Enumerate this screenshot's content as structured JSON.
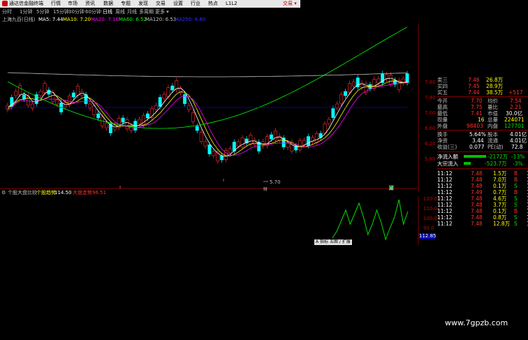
{
  "menu": {
    "app_title": "通达信金融终端",
    "items": [
      "行情",
      "市场",
      "资讯",
      "数据",
      "专题",
      "发现",
      "交易",
      "设置",
      "行业",
      "热点",
      "L1L2"
    ],
    "trade_label": "交易 ▾"
  },
  "period_bar": {
    "items": [
      "分时",
      "1分钟",
      "5分钟",
      "15分钟",
      "30分钟",
      "60分钟",
      "日线",
      "周线",
      "月线",
      "多周期",
      "更多 ▾"
    ],
    "active": "日线"
  },
  "ma_legend": {
    "stock_label": "上海九百(日线)",
    "ma5": "MA5: 7.44",
    "ma10": "MA10: 7.20",
    "ma20": "MA20: 7.16",
    "ma60": "MA60: 6.52",
    "ma120": "MA120: 6.53",
    "ma250": "MA250: 6.60",
    "colors": {
      "ma5": "#ffffff",
      "ma10": "#ffff00",
      "ma20": "#ff00ff",
      "ma60": "#00ff00",
      "ma120": "#c0c0c0",
      "ma250": "#0000ff"
    }
  },
  "main_chart": {
    "low_marker": "5.70",
    "event_marker": "财",
    "event_marker_right": "减",
    "axis_labels": [
      "7.80",
      "7.40",
      "7.00",
      "6.60",
      "6.20",
      "5.80"
    ]
  },
  "sub_chart": {
    "title": "个股大盘比较",
    "s1_label": "个股趋势",
    "s1_value": "114.50",
    "s2_label": "大盘走势",
    "s2_value": "96.51",
    "axis_labels": [
      "120.0",
      "110.0",
      "100.0",
      "90.0"
    ],
    "current_tag": "112.85",
    "tabs": [
      "A",
      "指标 五图",
      "/",
      "扩展"
    ]
  },
  "quote_panel": {
    "sell_rows": [
      {
        "label": "卖三",
        "price": "7.46",
        "vol": "26.8万"
      },
      {
        "label": "买四",
        "price": "7.45",
        "vol": "28.9万"
      },
      {
        "label": "买五",
        "price": "7.44",
        "vol": "38.5万",
        "extra": "+517"
      }
    ],
    "stats": [
      {
        "l1": "今开",
        "v1": "7.70",
        "l2": "均价",
        "v2": "7.54"
      },
      {
        "l1": "最高",
        "v1": "7.75",
        "l2": "量比",
        "v2": "2.21"
      },
      {
        "l1": "最低",
        "v1": "7.41",
        "l2": "市值",
        "v2": "30.0亿"
      },
      {
        "l1": "现量",
        "v1": "16",
        "l2": "总量",
        "v2": "224071"
      },
      {
        "l1": "外盘",
        "v1": "98403",
        "l2": "内盘",
        "v2": "127701"
      },
      {
        "l1": "换手",
        "v1": "5.64%",
        "l2": "股本",
        "v2": "4.01亿"
      },
      {
        "l1": "净资",
        "v1": "3.44",
        "l2": "流通",
        "v2": "4.01亿"
      },
      {
        "l1": "收益(三)",
        "v1": "0.077",
        "l2": "PE(动)",
        "v2": "72.8"
      }
    ],
    "flows": [
      {
        "label": "净流入额",
        "value": "-2172万",
        "pct": "-13%"
      },
      {
        "label": "大宗流入",
        "value": "-523.7万",
        "pct": "-3%"
      }
    ],
    "ticks": [
      {
        "time": "11:12",
        "price": "7.48",
        "vol": "1.5万",
        "side": "B",
        "n": "1"
      },
      {
        "time": "11:12",
        "price": "7.48",
        "vol": "7.0万",
        "side": "B",
        "n": "1"
      },
      {
        "time": "11:12",
        "price": "7.48",
        "vol": "0.1万",
        "side": "S",
        "n": "1"
      },
      {
        "time": "11:12",
        "price": "7.49",
        "vol": "0.7万",
        "side": "B",
        "n": "1"
      },
      {
        "time": "11:12",
        "price": "7.48",
        "vol": "4.6万",
        "side": "S",
        "n": "1"
      },
      {
        "time": "11:12",
        "price": "7.48",
        "vol": "3.7万",
        "side": "S",
        "n": "1"
      },
      {
        "time": "11:12",
        "price": "7.48",
        "vol": "0.1万",
        "side": "B",
        "n": "1"
      },
      {
        "time": "11:12",
        "price": "7.48",
        "vol": "0.8万",
        "side": "S",
        "n": "1"
      },
      {
        "time": "11:12",
        "price": "7.48",
        "vol": "12.8万",
        "side": "S",
        "n": "1"
      }
    ]
  },
  "watermark": "www.7gpzb.com"
}
